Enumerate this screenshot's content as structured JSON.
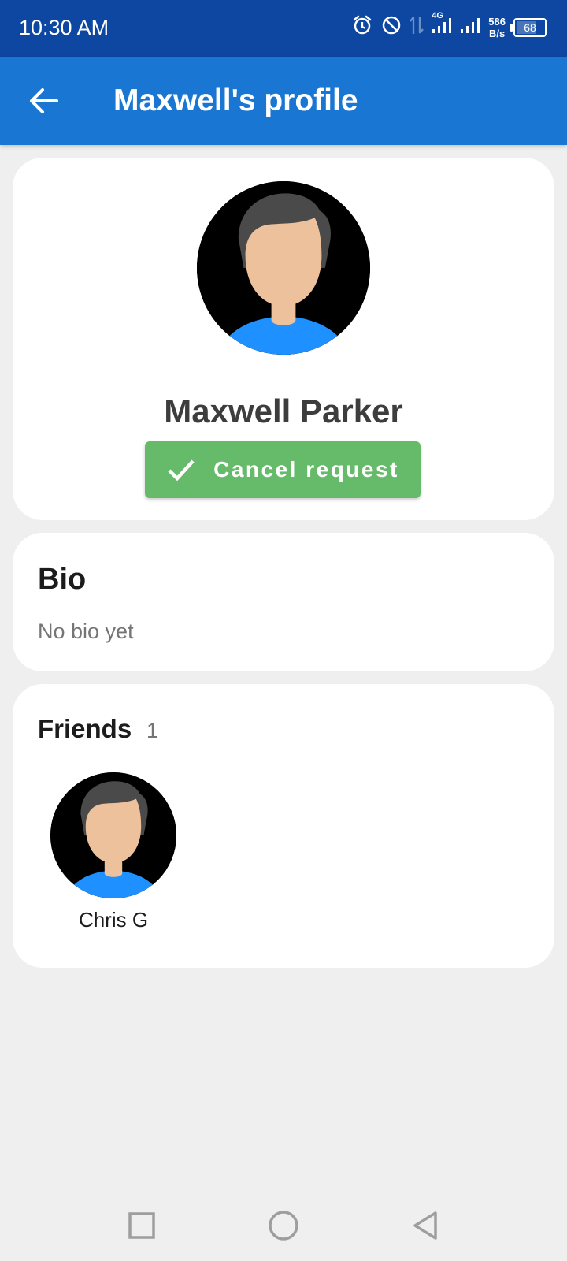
{
  "status_bar": {
    "time": "10:30 AM",
    "network": "4G",
    "speed_value": "586",
    "speed_unit": "B/s",
    "battery": "68",
    "icons": [
      "alarm-icon",
      "do-not-disturb-icon",
      "data-arrows-icon",
      "signal-4g-icon",
      "signal-icon",
      "battery-icon"
    ]
  },
  "app_bar": {
    "title": "Maxwell's profile",
    "back_icon": "arrow-back-icon",
    "color": "#1976d2"
  },
  "profile": {
    "name": "Maxwell Parker",
    "action_button": {
      "label": "Cancel request",
      "icon": "check-icon",
      "color": "#66bb6a"
    }
  },
  "bio": {
    "title": "Bio",
    "text": "No bio yet"
  },
  "friends": {
    "title": "Friends",
    "count": "1",
    "items": [
      {
        "name": "Chris G"
      }
    ]
  },
  "nav_bar": {
    "buttons": [
      "recents-square-icon",
      "home-circle-icon",
      "back-triangle-icon"
    ]
  },
  "colors": {
    "status_bar": "#0d47a1",
    "background": "#efefef",
    "avatar_hair": "#4a4a4a",
    "avatar_skin": "#ecc19c",
    "avatar_shirt": "#1e90ff"
  }
}
